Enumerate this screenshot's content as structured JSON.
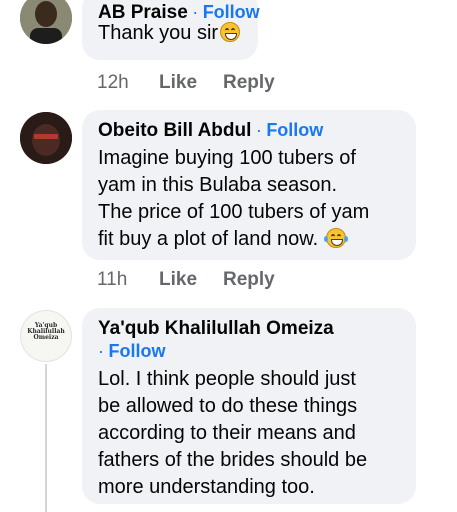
{
  "comments": [
    {
      "author": "AB Praise",
      "follow": "Follow",
      "text": "Thank you sir",
      "emoji": "grinning-squint-icon",
      "time": "12h",
      "like": "Like",
      "reply": "Reply"
    },
    {
      "author": "Obeito Bill Abdul",
      "follow": "Follow",
      "lines": [
        "Imagine buying 100 tubers of",
        "yam in this Bulaba season.",
        "The price of 100 tubers of yam",
        "fit buy a plot of land now."
      ],
      "emoji": "tears-of-joy-icon",
      "time": "11h",
      "like": "Like",
      "reply": "Reply"
    },
    {
      "author": "Ya'qub Khalilullah Omeiza",
      "follow": "Follow",
      "avatar_text": [
        "Ya'qub",
        "Khalilullah",
        "Omeiza"
      ],
      "lines": [
        "Lol. I think people should just",
        "be allowed to do these things",
        "according to their means and",
        "fathers of the brides should be",
        "more understanding too."
      ]
    }
  ],
  "colors": {
    "link": "#1877f2",
    "bubble": "#f0f2f5",
    "meta": "#65676b"
  }
}
